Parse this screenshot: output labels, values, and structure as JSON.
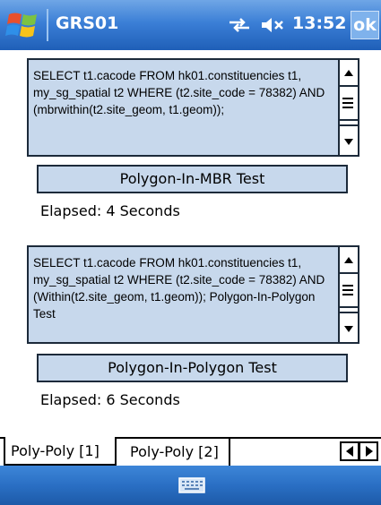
{
  "titlebar": {
    "app_title": "GRS01",
    "clock": "13:52",
    "ok_label": "ok"
  },
  "panel1": {
    "query": "SELECT t1.cacode FROM hk01.constituencies t1, my_sg_spatial t2 WHERE (t2.site_code = 78382) AND (mbrwithin(t2.site_geom, t1.geom));",
    "button_label": "Polygon-In-MBR Test",
    "elapsed": "Elapsed: 4 Seconds"
  },
  "panel2": {
    "query": "SELECT t1.cacode FROM hk01.constituencies t1, my_sg_spatial t2 WHERE (t2.site_code = 78382) AND (Within(t2.site_geom, t1.geom)); Polygon-In-Polygon Test",
    "button_label": "Polygon-In-Polygon Test",
    "elapsed": "Elapsed: 6 Seconds"
  },
  "tabs": [
    {
      "label": "Poly-Poly [1]",
      "selected": true
    },
    {
      "label": "Poly-Poly [2]",
      "selected": false
    }
  ],
  "icons": {
    "start": "windows-flag-icon",
    "network": "network-arrows-icon",
    "volume": "speaker-muted-icon",
    "keyboard": "keyboard-icon"
  },
  "colors": {
    "titlebar": "#3b7fd6",
    "control_fill": "#c7d8ec",
    "border": "#1c2a3a"
  }
}
